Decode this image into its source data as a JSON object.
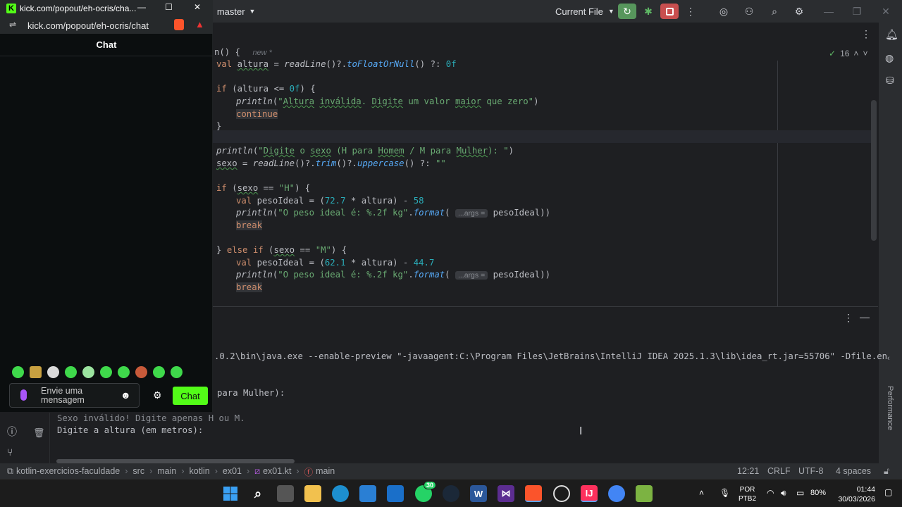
{
  "ide": {
    "branch": "master",
    "run_config": "Current File",
    "editor_tab_hint": "new *",
    "fn_fragment": "n() {",
    "inspection_count": "16",
    "code_lines": [
      "val altura = readLine()?.toFloatOrNull() ?: 0f",
      "if (altura <= 0f) {",
      "println(\"Altura inválida. Digite um valor maior que zero\")",
      "continue",
      "}",
      "println(\"Digite o sexo (H para Homem / M para Mulher): \")",
      "sexo = readLine()?.trim()?.uppercase() ?: \"\"",
      "if (sexo == \"H\") {",
      "val pesoIdeal = (72.7 * altura) - 58",
      "println(\"O peso ideal é: %.2f kg\".format(",
      "pesoIdeal))",
      "break",
      "} else if (sexo == \"M\") {",
      "val pesoIdeal = (62.1 * altura) - 44.7",
      "println(\"O peso ideal é: %.2f kg\".format(",
      "pesoIdeal))",
      "break"
    ],
    "param_hint": "...args =",
    "run_output": {
      "command": ".0.2\\bin\\java.exe --enable-preview \"-javaagent:C:\\Program Files\\JetBrains\\IntelliJ IDEA 2025.1.3\\lib\\idea_rt.jar=55706\" -Dfile.en",
      "line2": "para Mulher):",
      "line3": "Sexo inválido! Digite apenas H ou M.",
      "line4": "Digite a altura (em metros):"
    },
    "performance_label": "Performance",
    "statusbar": {
      "breadcrumbs": [
        "kotlin-exercicios-faculdade",
        "src",
        "main",
        "kotlin",
        "ex01",
        "ex01.kt",
        "main"
      ],
      "position": "12:21",
      "line_sep": "CRLF",
      "encoding": "UTF-8",
      "indent": "4 spaces"
    }
  },
  "popout": {
    "title": "kick.com/popout/eh-ocris/cha...",
    "url": "kick.com/popout/eh-ocris/chat",
    "chat_header": "Chat",
    "input_placeholder_line1": "Envie uma",
    "input_placeholder_line2": "mensagem",
    "send_label": "Chat",
    "accent": "#53fc18"
  },
  "taskbar": {
    "whatsapp_badge": "30",
    "lang_line1": "POR",
    "lang_line2": "PTB2",
    "battery": "80%",
    "time": "01:44",
    "date": "30/03/2026"
  }
}
